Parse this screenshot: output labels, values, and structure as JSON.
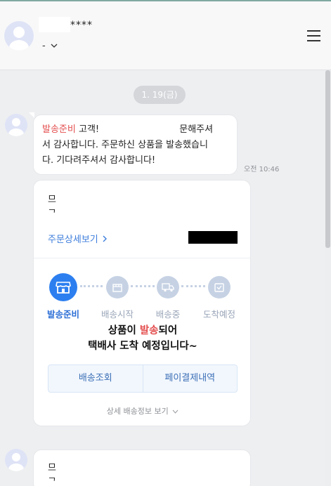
{
  "header": {
    "masked_name": "****",
    "status_text": "-",
    "menu_icon": "hamburger-menu-icon"
  },
  "date_divider": "1. 19(금)",
  "message": {
    "status_word": "발송준비",
    "line1_a": "고객!",
    "line1_b": "문해주셔",
    "line2": "서 감사합니다. 주문하신 상품을 발송했습니",
    "line3": "다. 기다려주셔서 감사합니다!",
    "time": "오전 10:46"
  },
  "card": {
    "text_line1": "므",
    "text_line2": "ᄀ",
    "detail_link": "주문상세보기",
    "steps": [
      {
        "label": "발송준비",
        "icon": "store-icon",
        "active": true
      },
      {
        "label": "배송시작",
        "icon": "box-icon",
        "active": false
      },
      {
        "label": "배송중",
        "icon": "truck-icon",
        "active": false
      },
      {
        "label": "도착예정",
        "icon": "delivered-box-icon",
        "active": false
      }
    ],
    "headline_prefix": "상품이 ",
    "headline_highlight": "발송",
    "headline_suffix": "되어",
    "headline_line2": "택배사 도착 예정입니다~",
    "buttons": [
      "배송조회",
      "페이결제내역"
    ],
    "more_link": "상세 배송정보 보기"
  },
  "card2": {
    "text_line1": "므",
    "text_line2": "ᄀ"
  },
  "colors": {
    "accent_blue": "#2d7ff0",
    "highlight_red": "#e44f4f",
    "inactive_step": "#c6d2e4"
  }
}
